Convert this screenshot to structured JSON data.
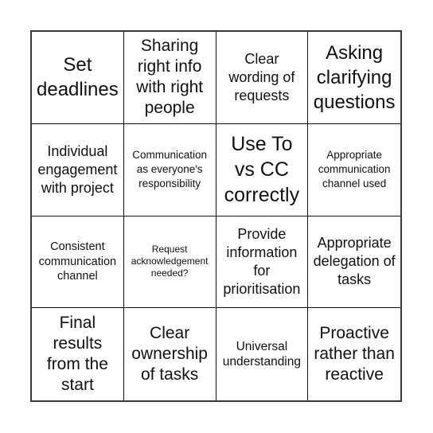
{
  "card": {
    "rows": [
      [
        {
          "text": "Set deadlines",
          "size": "xl"
        },
        {
          "text": "Sharing right info with right people",
          "size": "lg"
        },
        {
          "text": "Clear wording of requests",
          "size": "lg"
        },
        {
          "text": "Asking clarifying questions",
          "size": "xl"
        }
      ],
      [
        {
          "text": "Individual engagement with project",
          "size": "md"
        },
        {
          "text": "Communication as everyone's responsibility",
          "size": "xs"
        },
        {
          "text": "Use To vs CC correctly",
          "size": "xl"
        },
        {
          "text": "Appropriate communication channel used",
          "size": "xs"
        }
      ],
      [
        {
          "text": "Consistent communication channel",
          "size": "sm"
        },
        {
          "text": "Request acknowledgement needed?",
          "size": "xxs"
        },
        {
          "text": "Provide information for prioritisation",
          "size": "md"
        },
        {
          "text": "Appropriate delegation of tasks",
          "size": "md"
        }
      ],
      [
        {
          "text": "Final results from the start",
          "size": "lg"
        },
        {
          "text": "Clear ownership of tasks",
          "size": "lg"
        },
        {
          "text": "Universal understanding",
          "size": "sm"
        },
        {
          "text": "Proactive rather than reactive",
          "size": "lg"
        }
      ]
    ]
  }
}
